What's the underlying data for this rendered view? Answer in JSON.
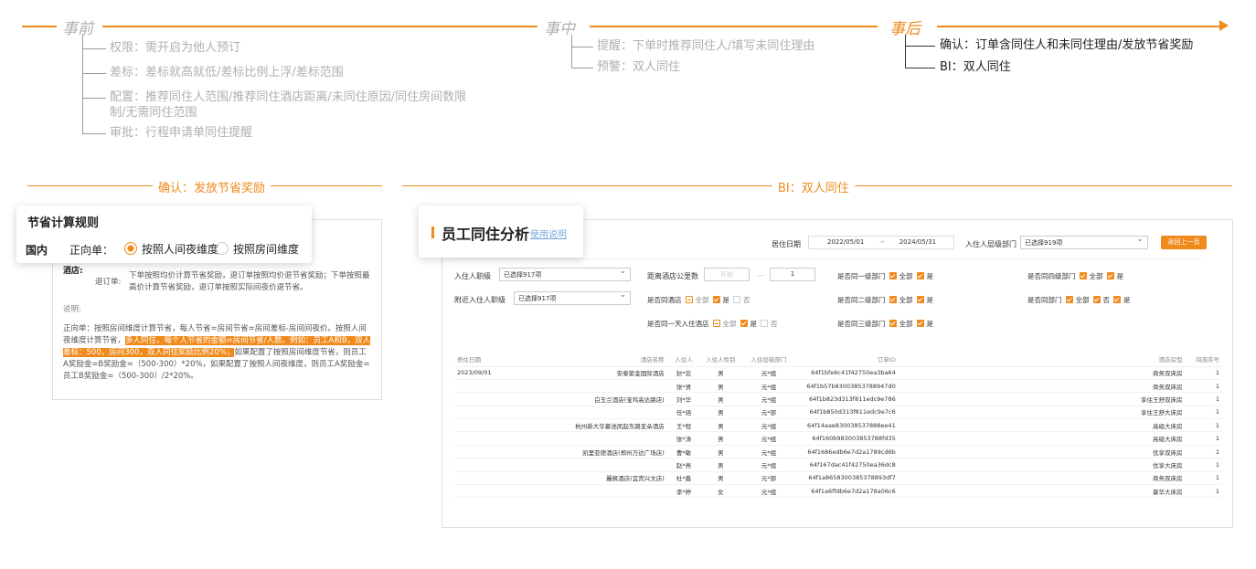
{
  "stages": {
    "before": {
      "title": "事前",
      "items": [
        "权限：需开启为他人预订",
        "差标：差标就高就低/差标比例上浮/差标范围",
        "配置：推荐同住人范围/推荐同住酒店距离/未同住原因/同住房间数限",
        "制/无需同住范围",
        "审批：行程申请单同住提醒"
      ]
    },
    "during": {
      "title": "事中",
      "items": [
        "提醒：下单时推荐同住人/填写未同住理由",
        "预警：双人同住"
      ]
    },
    "after": {
      "title": "事后",
      "items": [
        "确认：订单含同住人和未同住理由/发放节省奖励",
        "BI：双人同住"
      ]
    }
  },
  "sections": {
    "left_label": "确认：发放节省奖励",
    "right_label": "BI：双人同住"
  },
  "rule_card": {
    "title": "节省计算规则",
    "domestic": "国内",
    "forward_label": "正向单：",
    "option_night": "按照人间夜维度",
    "option_room": "按照房间维度",
    "hotel_label": "酒店:",
    "refund_label": "退订单:",
    "refund_text_1": "下单按照均价计算节省奖励，退订单按照均价退节省奖励；下单按照最",
    "refund_text_2": "高价计算节省奖励，退订单按照实际间夜价退节省。",
    "note_label": "说明:",
    "note_1": "正向单：按照房间维度计算节省，每人节省=房间节省=房间差标-房间间夜价。按照人间",
    "note_2a": "夜维度计算节省，",
    "note_2b": "多人同住，每个人节省的金额=房间节省/人数。例如：员工A和B，双人",
    "note_3a": "差标：500，房间300，双人同住奖励比例20%；",
    "note_3b": "如果配置了按照房间维度节省，则员工",
    "note_4": "A奖励金=B奖励金=（500-300）*20%，如果配置了按照人间夜维度，则员工A奖励金=",
    "note_5": "员工B奖励金=（500-300）/2*20%。"
  },
  "app": {
    "title": "员工同住分析",
    "help_link": "使用说明",
    "date_label": "居住日期",
    "date_start": "2022/05/01",
    "date_sep": "→",
    "date_end": "2024/05/31",
    "dept_label": "入住人层级部门",
    "dept_value": "已选择919项",
    "back_button": "返回上一页",
    "guest_rank_label": "入住人职级",
    "guest_rank_value": "已选择917项",
    "near_rank_label": "附近入住人职级",
    "near_rank_value": "已选择917项",
    "distance_label": "距离酒店公里数",
    "distance_start_placeholder": "开始",
    "distance_dash": "—",
    "distance_end": "1",
    "same_hotel_label": "是否同酒店",
    "same_day_label": "是否同一天入住酒店",
    "dept1_label": "是否同一级部门",
    "dept2_label": "是否同二级部门",
    "dept3_label": "是否同三级部门",
    "dept4_label": "是否同四级部门",
    "same_dept_label": "是否同部门",
    "opt_all": "全部",
    "opt_yes": "是",
    "opt_no": "否"
  },
  "table": {
    "columns": [
      "居住日期",
      "酒店名称",
      "入住人",
      "入住人性别",
      "入住层级部门",
      "订单ID",
      "酒店房型",
      "间夜序号"
    ],
    "rows": [
      [
        "2023/09/01",
        "安泰紫金国际酒店",
        "狄*忠",
        "男",
        "元*组",
        "64f1bfe6c41f42750ea3ba64",
        "商务双床房",
        "1"
      ],
      [
        "",
        "",
        "张*贤",
        "男",
        "元*组",
        "64f1b57b83003853788947d0",
        "商务双床房",
        "1"
      ],
      [
        "",
        "白玉兰酒店(宝鸡高达路店)",
        "刘*华",
        "男",
        "元*组",
        "64f1b823d313f811edc9e786",
        "享住王舒双床房",
        "1"
      ],
      [
        "",
        "",
        "任*涵",
        "男",
        "元*部",
        "64f1b850d313f811edc9e7c6",
        "享住王舒大床房",
        "1"
      ],
      [
        "",
        "杭州新大华豪池凤起东路亚朵酒店",
        "王*程",
        "男",
        "元*组",
        "64f14aae830038537888ee41",
        "高级大床房",
        "1"
      ],
      [
        "",
        "",
        "张*涛",
        "男",
        "元*组",
        "64f160b983003853788fd35",
        "高级大床房",
        "1"
      ],
      [
        "",
        "凯里亚德酒店(郑州万达广场店)",
        "曹*敏",
        "男",
        "元*组",
        "64f1686edb6e7d2a1789cd6b",
        "优享双床房",
        "1"
      ],
      [
        "",
        "",
        "赵*亮",
        "男",
        "元*组",
        "64f167dac41f42750ea36dc8",
        "优享大床房",
        "1"
      ],
      [
        "",
        "麗枫酒店(宜宾兴文店)",
        "杜*鑫",
        "男",
        "元*部",
        "64f1a8658300385378893df7",
        "商务双床房",
        "1"
      ],
      [
        "",
        "",
        "李*婷",
        "女",
        "元*组",
        "64f1a6ffdb6e7d2a178a06c6",
        "豪华大床房",
        "1"
      ]
    ]
  },
  "colors": {
    "accent": "#f08a1c",
    "muted": "#b0b0b0"
  }
}
